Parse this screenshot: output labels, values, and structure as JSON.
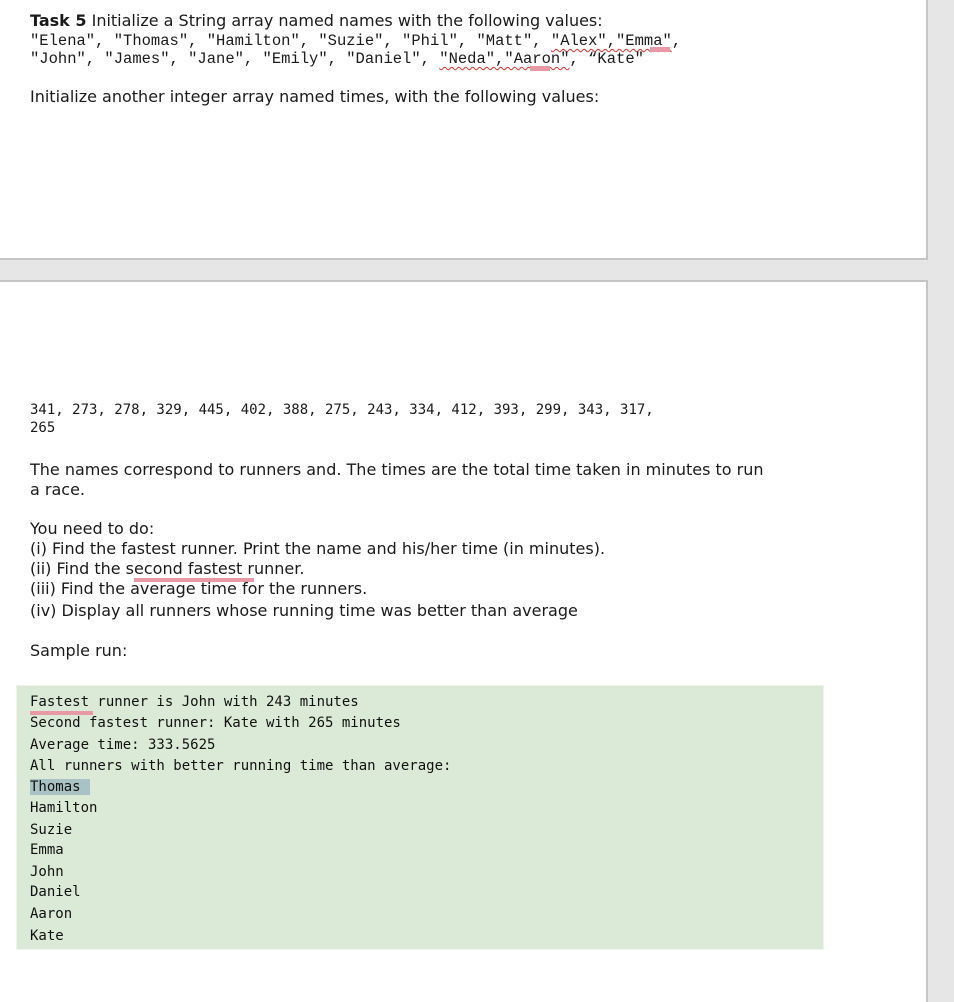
{
  "task": {
    "label": "Task 5",
    "intro": " Initialize a String array named names with the following values:",
    "names_line1_a": "\"Elena\", \"Thomas\", \"Hamilton\", \"Suzie\", \"Phil\", \"Matt\", ",
    "names_line1_b": "\"Alex\",\"Emma\"",
    "names_line1_c": ",",
    "names_line2_a": "\"John\", \"James\", \"Jane\", \"Emily\", \"Daniel\", ",
    "names_line2_b": "\"Neda\",\"Aaron\"",
    "names_line2_c": ", “Kate\"",
    "times_intro": "Initialize another integer array named times, with the following values:",
    "times_line1": "341, 273, 278, 329, 445, 402, 388, 275, 243, 334, 412, 393, 299, 343, 317,",
    "times_line2": "265",
    "desc_line1": "The names correspond to runners and. The times are the total time taken in minutes to run",
    "desc_line2": "a race.",
    "todo_heading": "You need to do:",
    "todo": [
      "(i) Find the fastest runner. Print the name and his/her time (in minutes).",
      "(ii) Find the second fastest runner.",
      "(iii) Find the average time for the runners.",
      "(iv) Display all runners whose running time was better than average"
    ],
    "sample_label": "Sample run:"
  },
  "names": [
    "Elena",
    "Thomas",
    "Hamilton",
    "Suzie",
    "Phil",
    "Matt",
    "Alex",
    "Emma",
    "John",
    "James",
    "Jane",
    "Emily",
    "Daniel",
    "Neda",
    "Aaron",
    "Kate"
  ],
  "times": [
    341,
    273,
    278,
    329,
    445,
    402,
    388,
    275,
    243,
    334,
    412,
    393,
    299,
    343,
    317,
    265
  ],
  "sample_run": {
    "lines": [
      "Fastest runner is John with 243 minutes",
      "Second fastest runner: Kate with 265 minutes",
      "Average time: 333.5625",
      "All runners with better running time than average:",
      "Thomas",
      "Hamilton",
      "Suzie",
      "Emma",
      "John",
      "Daniel",
      "Aaron",
      "Kate"
    ]
  },
  "colors": {
    "page_bg": "#ffffff",
    "viewer_bg": "#e6e6e6",
    "sample_bg": "#dbead6",
    "selection_highlight": "#a9c2c3",
    "spellcheck_red": "#d9302c",
    "mark_pink": "#e79aa5"
  }
}
